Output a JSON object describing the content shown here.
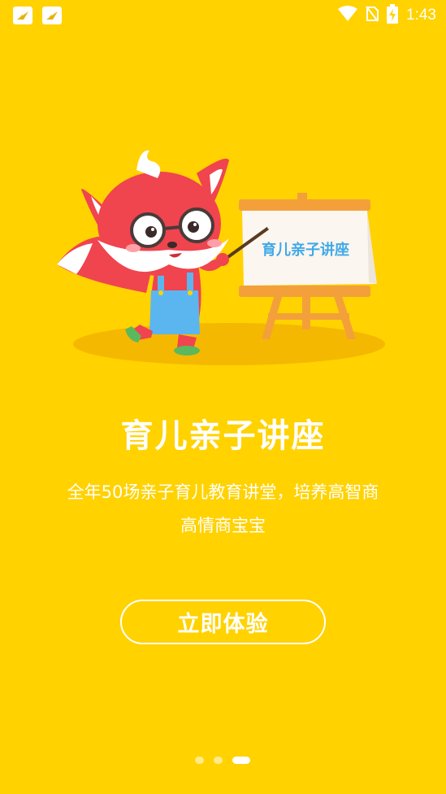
{
  "status_bar": {
    "time": "1:43",
    "left_icons": [
      "app-notification-icon",
      "app-notification-icon"
    ],
    "right_icons": [
      "wifi-icon",
      "no-sim-icon",
      "battery-charging-icon"
    ]
  },
  "illustration": {
    "board_text": "育儿亲子讲座"
  },
  "main": {
    "title": "育儿亲子讲座",
    "description_line1": "全年50场亲子育儿教育讲堂，培养高智商",
    "description_line2": "高情商宝宝",
    "cta_label": "立即体验"
  },
  "pager": {
    "total": 3,
    "current": 3
  },
  "colors": {
    "background": "#FFD200",
    "text": "#FFFFFF",
    "board_text": "#3FA9E8",
    "fox": "#F0444F"
  }
}
